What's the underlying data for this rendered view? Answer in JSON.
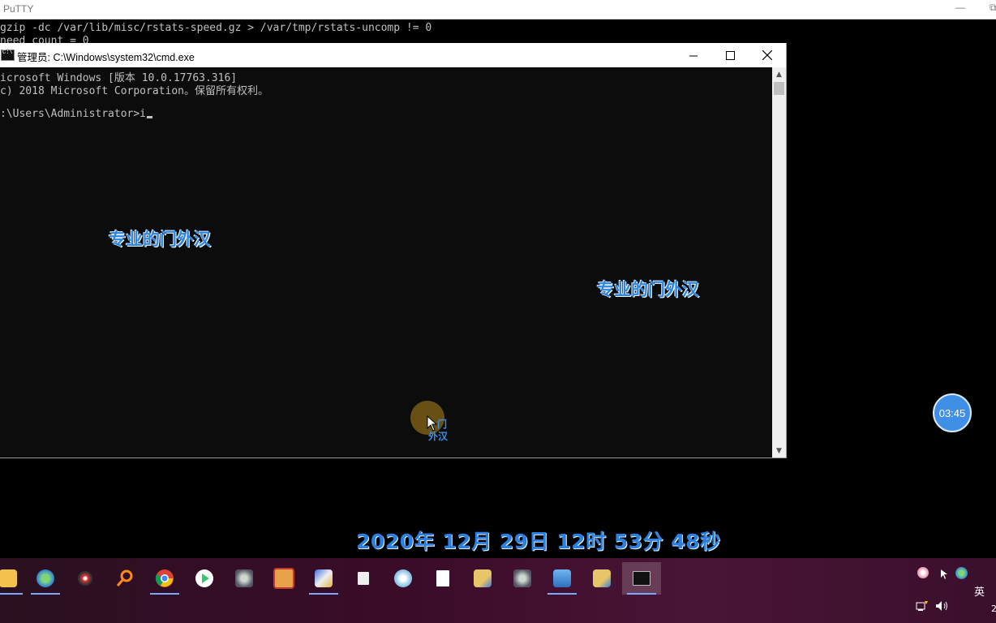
{
  "putty": {
    "title": "PuTTY",
    "restore_glyph": "⧉",
    "lines": [
      "gzip -dc /var/lib/misc/rstats-speed.gz > /var/tmp/rstats-uncomp != 0",
      "need_count = 0"
    ]
  },
  "cmd": {
    "title": "管理员: C:\\Windows\\system32\\cmd.exe",
    "lines": [
      "icrosoft Windows [版本 10.0.17763.316]",
      "c) 2018 Microsoft Corporation。保留所有权利。",
      "",
      ":\\Users\\Administrator>i"
    ]
  },
  "watermarks": {
    "text_left": "专业的门外汉",
    "text_right": "专业的门外汉",
    "cursor_label_line1": "门",
    "cursor_label_line2": "外汉",
    "date": "2020年 12月 29日 12时 53分 48秒"
  },
  "timer": {
    "value": "03:45"
  },
  "taskbar": {
    "icons": [
      "file-explorer-icon",
      "ie-network-icon",
      "media-icon",
      "search-magnifier-icon",
      "chrome-icon",
      "play-icon",
      "settings-gear-icon",
      "app-orange-icon",
      "network-tool-icon",
      "folder-doc-icon",
      "flower-app-icon",
      "document-icon",
      "search-folder-icon",
      "settings-gear-icon-2",
      "computer-app-icon",
      "search-folder-icon-2",
      "cmd-icon"
    ],
    "tray_ime": "英",
    "tray_clock_partial": "2"
  },
  "colors": {
    "accent_blue": "#2e86e0",
    "taskbar": "#3a0c28",
    "cmd_bg": "#0c0c0c"
  }
}
